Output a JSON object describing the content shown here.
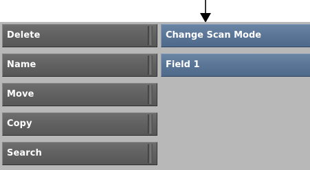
{
  "menu": {
    "items": [
      {
        "label": "Delete"
      },
      {
        "label": "Name"
      },
      {
        "label": "Move"
      },
      {
        "label": "Copy"
      },
      {
        "label": "Search"
      }
    ]
  },
  "fields": {
    "scan_mode_label": "Change Scan Mode",
    "field_value": "Field 1"
  },
  "colors": {
    "panel_bg": "#b8b8b8",
    "button_grey": "#626262",
    "field_blue": "#5b7597",
    "text": "#ffffff",
    "callout_arrow": "#000000"
  },
  "icons": {
    "callout": "down-arrow-icon"
  }
}
